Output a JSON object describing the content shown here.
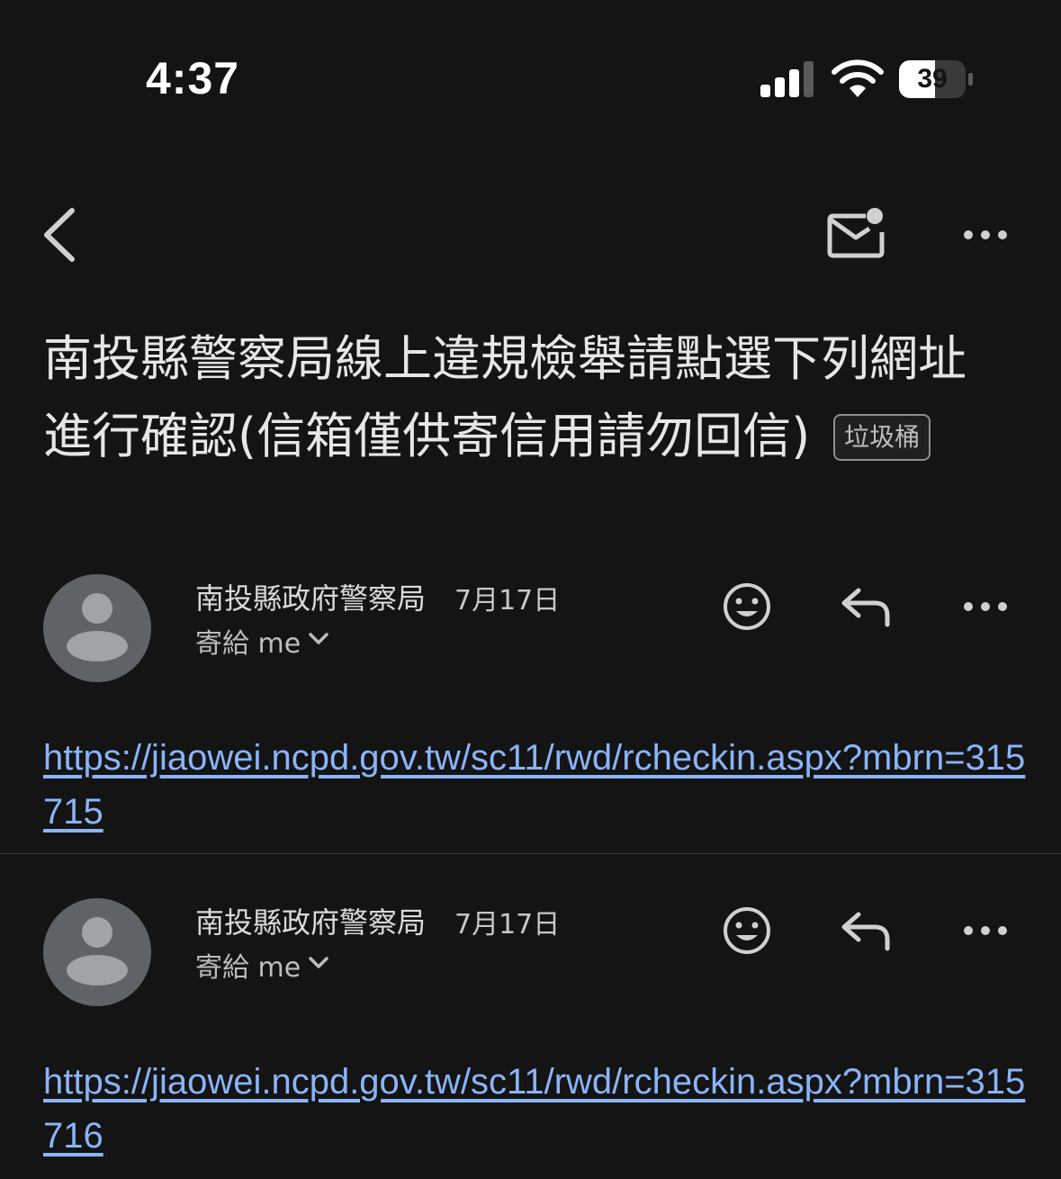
{
  "status_bar": {
    "time": "4:37",
    "battery_level": "39",
    "signal_bars_active": 3,
    "signal_bars_total": 4
  },
  "toolbar": {
    "back_icon": "chevron-left-icon",
    "mail_icon": "mark-unread-icon",
    "more_icon": "more-horizontal-icon"
  },
  "email": {
    "subject_line1": "南投縣警察局線上違規檢舉請點選下列網址",
    "subject_line2": "進行確認(信箱僅供寄信用請勿回信)",
    "label": "垃圾桶"
  },
  "messages": [
    {
      "sender": "南投縣政府警察局",
      "date": "7月17日",
      "recipient": "寄給 me",
      "link": "https://jiaowei.ncpd.gov.tw/sc11/rwd/rcheckin.aspx?mbrn=315715"
    },
    {
      "sender": "南投縣政府警察局",
      "date": "7月17日",
      "recipient": "寄給 me",
      "link": "https://jiaowei.ncpd.gov.tw/sc11/rwd/rcheckin.aspx?mbrn=315716"
    }
  ],
  "colors": {
    "background": "#141414",
    "link": "#8ab4f8",
    "avatar": "#5f6368"
  }
}
